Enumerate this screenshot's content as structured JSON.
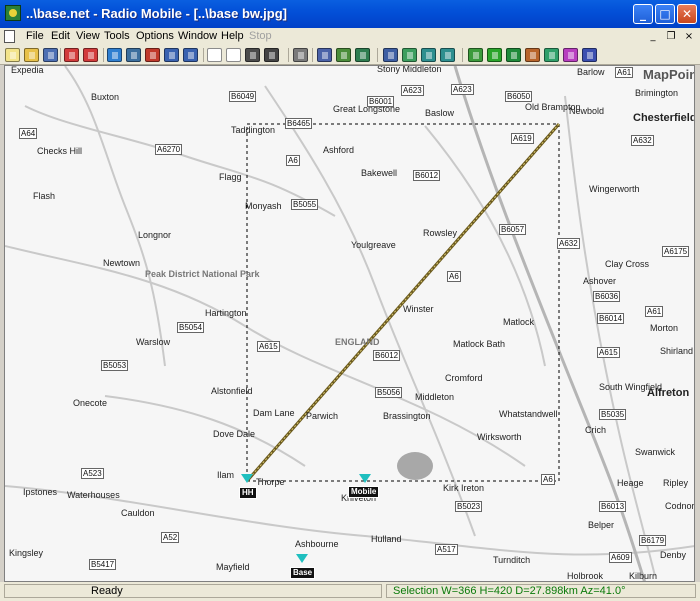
{
  "window": {
    "title": "..\\base.net - Radio Mobile - [..\\base bw.jpg]",
    "minimize_glyph": "_",
    "maximize_glyph": "□",
    "close_glyph": "✕"
  },
  "menu": {
    "items": [
      "File",
      "Edit",
      "View",
      "Tools",
      "Options",
      "Window",
      "Help",
      "Stop"
    ],
    "mdi_minimize": "_",
    "mdi_restore": "❐",
    "mdi_close": "×"
  },
  "toolbar": {
    "buttons": [
      {
        "icon": "new-network-icon",
        "color": "#f3e48a"
      },
      {
        "icon": "open-folder-icon",
        "color": "#e8c14a"
      },
      {
        "icon": "save-icon",
        "color": "#4d6fb3"
      },
      {
        "icon": "properties-icon",
        "color": "#d23b3b"
      },
      {
        "icon": "network-units-icon",
        "color": "#d23b3b"
      },
      {
        "icon": "world-map-icon",
        "color": "#2f7fd0"
      },
      {
        "icon": "cartesian-icon",
        "color": "#3c6f9e"
      },
      {
        "icon": "satellite-icon",
        "color": "#c0392b"
      },
      {
        "icon": "undo-icon",
        "color": "#3a62b0"
      },
      {
        "icon": "redo-icon",
        "color": "#3a62b0"
      },
      {
        "icon": "page-icon",
        "color": "#ffffff"
      },
      {
        "icon": "page-edit-icon",
        "color": "#ffffff"
      },
      {
        "icon": "save-picture-icon",
        "color": "#4b4b4b"
      },
      {
        "icon": "export-icon",
        "color": "#444444"
      },
      {
        "icon": "print-icon",
        "color": "#7a7a7a"
      },
      {
        "icon": "copy-icon",
        "color": "#4b62a8"
      },
      {
        "icon": "paste-icon",
        "color": "#4b8d3a"
      },
      {
        "icon": "merge-icon",
        "color": "#2e7d4f"
      },
      {
        "icon": "window-icon",
        "color": "#3e5fa3"
      },
      {
        "icon": "fit-icon",
        "color": "#3c9e5e"
      },
      {
        "icon": "select-icon",
        "color": "#2e8f8f"
      },
      {
        "icon": "grid-icon",
        "color": "#2e8f8f"
      },
      {
        "icon": "antenna-icon",
        "color": "#3b9a3b"
      },
      {
        "icon": "radar-icon",
        "color": "#2aa52a"
      },
      {
        "icon": "globe-icon",
        "color": "#1f8a3a"
      },
      {
        "icon": "tower-icon",
        "color": "#b8642a"
      },
      {
        "icon": "network-map-icon",
        "color": "#30a06a"
      },
      {
        "icon": "coverage-icon",
        "color": "#b83fbf"
      },
      {
        "icon": "spectrum-icon",
        "color": "#3b4fb0"
      }
    ]
  },
  "map": {
    "places": [
      {
        "name": "Expedia",
        "bold": false
      },
      {
        "name": "Buxton",
        "bold": false
      },
      {
        "name": "Stony Middleton",
        "bold": false
      },
      {
        "name": "Great Longstone",
        "bold": false
      },
      {
        "name": "Baslow",
        "bold": false
      },
      {
        "name": "Barlow",
        "bold": false
      },
      {
        "name": "Brimington",
        "bold": false
      },
      {
        "name": "MapPoint",
        "bold": true
      },
      {
        "name": "Taddington",
        "bold": false
      },
      {
        "name": "Old Brampton",
        "bold": false
      },
      {
        "name": "Newbold",
        "bold": false
      },
      {
        "name": "Chesterfield",
        "bold": true
      },
      {
        "name": "Checks Hill",
        "bold": false
      },
      {
        "name": "Ashford",
        "bold": false
      },
      {
        "name": "Bakewell",
        "bold": false
      },
      {
        "name": "Flagg",
        "bold": false
      },
      {
        "name": "Flash",
        "bold": false
      },
      {
        "name": "Wingerworth",
        "bold": false
      },
      {
        "name": "Monyash",
        "bold": false
      },
      {
        "name": "Longnor",
        "bold": false
      },
      {
        "name": "Rowsley",
        "bold": false
      },
      {
        "name": "Youlgreave",
        "bold": false
      },
      {
        "name": "Newtown",
        "bold": false
      },
      {
        "name": "Peak District National Park",
        "bold": false
      },
      {
        "name": "Clay Cross",
        "bold": false
      },
      {
        "name": "Ashover",
        "bold": false
      },
      {
        "name": "Hartington",
        "bold": false
      },
      {
        "name": "Winster",
        "bold": false
      },
      {
        "name": "Matlock",
        "bold": false
      },
      {
        "name": "Morton",
        "bold": false
      },
      {
        "name": "Warslow",
        "bold": false
      },
      {
        "name": "ENGLAND",
        "bold": false
      },
      {
        "name": "Matlock Bath",
        "bold": false
      },
      {
        "name": "Shirland",
        "bold": false
      },
      {
        "name": "Alstonfield",
        "bold": false
      },
      {
        "name": "Cromford",
        "bold": false
      },
      {
        "name": "South Wingfield",
        "bold": false
      },
      {
        "name": "Alfreton",
        "bold": true
      },
      {
        "name": "Onecote",
        "bold": false
      },
      {
        "name": "Middleton",
        "bold": false
      },
      {
        "name": "Dam Lane",
        "bold": false
      },
      {
        "name": "Parwich",
        "bold": false
      },
      {
        "name": "Brassington",
        "bold": false
      },
      {
        "name": "Whatstandwell",
        "bold": false
      },
      {
        "name": "Crich",
        "bold": false
      },
      {
        "name": "Dove Dale",
        "bold": false
      },
      {
        "name": "Wirksworth",
        "bold": false
      },
      {
        "name": "Swanwick",
        "bold": false
      },
      {
        "name": "Ilam",
        "bold": false
      },
      {
        "name": "Thorpe",
        "bold": false
      },
      {
        "name": "Kniveton",
        "bold": false
      },
      {
        "name": "Kirk Ireton",
        "bold": false
      },
      {
        "name": "Heage",
        "bold": false
      },
      {
        "name": "Ripley",
        "bold": false
      },
      {
        "name": "Ipstones",
        "bold": false
      },
      {
        "name": "Waterhouses",
        "bold": false
      },
      {
        "name": "Codnor",
        "bold": false
      },
      {
        "name": "Cauldon",
        "bold": false
      },
      {
        "name": "Belper",
        "bold": false
      },
      {
        "name": "Ashbourne",
        "bold": false
      },
      {
        "name": "Hulland",
        "bold": false
      },
      {
        "name": "Denby",
        "bold": false
      },
      {
        "name": "Kingsley",
        "bold": false
      },
      {
        "name": "Mayfield",
        "bold": false
      },
      {
        "name": "Turnditch",
        "bold": false
      },
      {
        "name": "Kilburn",
        "bold": false
      },
      {
        "name": "Holbrook",
        "bold": false
      }
    ],
    "roads": [
      "B6049",
      "A623",
      "B6001",
      "A623",
      "B6050",
      "A61",
      "A64",
      "B6465",
      "A619",
      "A632",
      "A6270",
      "A6",
      "B6012",
      "B5055",
      "B6057",
      "A632",
      "A6175",
      "A6",
      "B6036",
      "A61",
      "B5054",
      "A615",
      "B6014",
      "B5053",
      "B6012",
      "A615",
      "B5056",
      "B5035",
      "A523",
      "A6",
      "B5023",
      "B6013",
      "A52",
      "B5417",
      "A517",
      "A609",
      "B6179"
    ],
    "markers": [
      {
        "name": "HH"
      },
      {
        "name": "Mobile"
      },
      {
        "name": "Base"
      }
    ]
  },
  "status": {
    "left": "Ready",
    "right": "Selection W=366 H=420 D=27.898km Az=41.0°"
  }
}
